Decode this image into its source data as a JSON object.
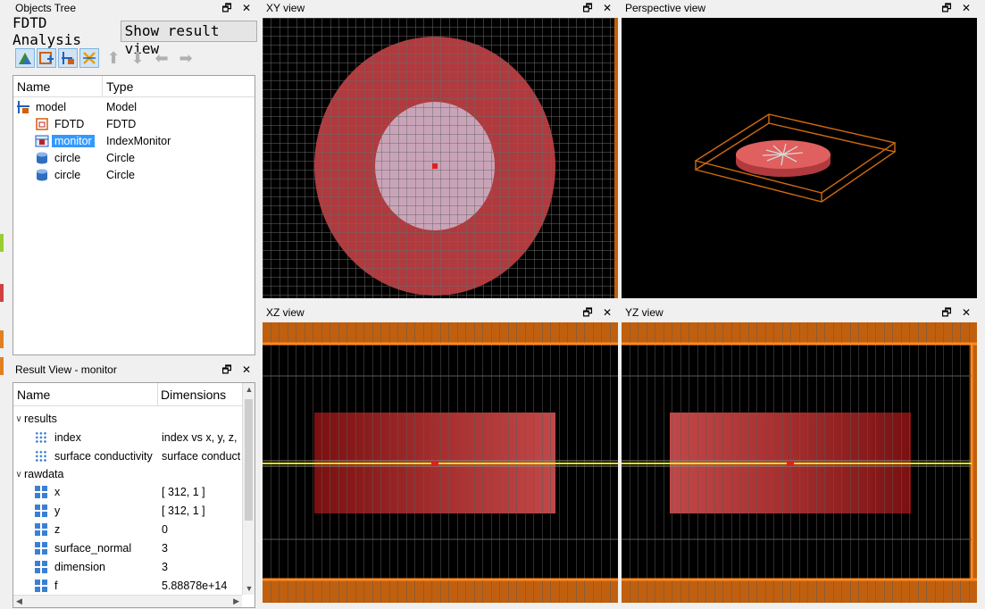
{
  "objects_tree": {
    "title": "Objects Tree",
    "analysis_label": "FDTD Analysis",
    "show_result_button": "Show result view",
    "columns": [
      "Name",
      "Type"
    ],
    "rows": [
      {
        "name": "model",
        "type": "Model",
        "icon": "model-icon"
      },
      {
        "name": "FDTD",
        "type": "FDTD",
        "icon": "fdtd-icon"
      },
      {
        "name": "monitor",
        "type": "IndexMonitor",
        "icon": "index-monitor-icon",
        "selected": true
      },
      {
        "name": "circle",
        "type": "Circle",
        "icon": "cylinder-icon"
      },
      {
        "name": "circle",
        "type": "Circle",
        "icon": "cylinder-icon"
      }
    ]
  },
  "result_view": {
    "title": "Result View - monitor",
    "columns": [
      "Name",
      "Dimensions"
    ],
    "groups": [
      {
        "label": "results",
        "items": [
          {
            "name": "index",
            "value": "index vs x, y, z,",
            "icon": "dotted-grid-icon"
          },
          {
            "name": "surface conductivity",
            "value": "surface conduct",
            "icon": "dotted-grid-icon"
          }
        ]
      },
      {
        "label": "rawdata",
        "items": [
          {
            "name": "x",
            "value": "[ 312, 1 ]",
            "icon": "grid-icon"
          },
          {
            "name": "y",
            "value": "[ 312, 1 ]",
            "icon": "grid-icon"
          },
          {
            "name": "z",
            "value": "0",
            "icon": "grid-icon"
          },
          {
            "name": "surface_normal",
            "value": "3",
            "icon": "grid-icon"
          },
          {
            "name": "dimension",
            "value": "3",
            "icon": "grid-icon"
          },
          {
            "name": "f",
            "value": "5.88878e+14",
            "icon": "grid-icon"
          }
        ]
      }
    ]
  },
  "views": {
    "xy": "XY view",
    "perspective": "Perspective view",
    "xz": "XZ view",
    "yz": "YZ view"
  },
  "dock_buttons": {
    "float": "🗗",
    "close": "✕"
  },
  "colors": {
    "outer_disk": "#b03a3e",
    "inner_disk": "#c9a4b8",
    "pml_orange": "#c0600f",
    "selection": "#3399ff",
    "monitor_line": "#e8e800"
  }
}
